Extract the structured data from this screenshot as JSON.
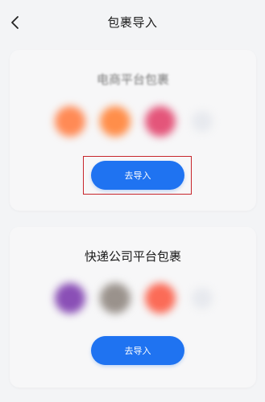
{
  "header": {
    "title": "包裹导入",
    "back_icon": "chevron-left-icon"
  },
  "cards": [
    {
      "title": "电商平台包裹",
      "button_label": "去导入",
      "logo_colors": [
        "#ff8a55",
        "#ff8e4a",
        "#e4557a",
        "#e7e9ee"
      ],
      "highlighted": true
    },
    {
      "title": "快递公司平台包裹",
      "button_label": "去导入",
      "logo_colors": [
        "#8a4fb6",
        "#9a928c",
        "#fb6b57",
        "#e7e9ee"
      ],
      "highlighted": false
    }
  ],
  "colors": {
    "accent": "#1f73f1",
    "background": "#f3f4f6",
    "highlight": "#c7252b"
  }
}
